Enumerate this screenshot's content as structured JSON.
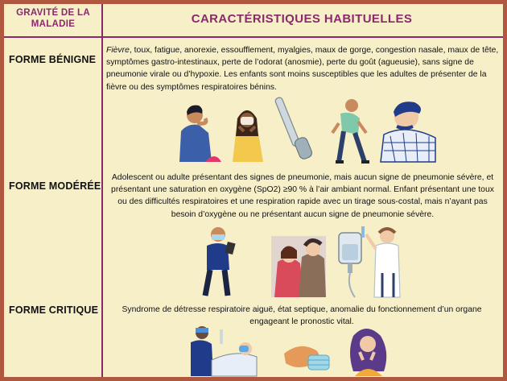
{
  "header": {
    "col_left": "GRAVITÉ DE LA MALADIE",
    "col_right": "CARACTÉRISTIQUES HABITUELLES"
  },
  "rows": [
    {
      "label": "FORME BÉNIGNE",
      "lead": "Fièvre",
      "text": ", toux, fatigue, anorexie, essoufflement, myalgies, maux de gorge, congestion nasale, maux de tête, symptômes gastro-intestinaux, perte de l’odorat (anosmie), perte du goût (agueusie), sans signe de pneumonie virale ou d’hypoxie. Les enfants sont moins susceptibles que les adultes de présenter de la fièvre ou des symptômes respiratoires bénins.",
      "icons": [
        "coughing-person-icon",
        "sneezing-woman-icon",
        "thermometer-icon",
        "tired-runner-icon",
        "coughing-man-icon"
      ]
    },
    {
      "label": "FORME MODÉRÉE",
      "text": "Adolescent ou adulte présentant des signes de pneumonie, mais aucun signe de pneumonie sévère, et présentant une saturation en oxygène (SpO2) ≥90 % à l’air ambiant normal. Enfant présentant une toux ou des difficultés respiratoires et une respiration rapide avec un tirage sous-costal, mais n’ayant pas besoin d’oxygène ou ne présentant aucun signe de pneumonie sévère.",
      "icons": [
        "doctor-tablet-icon",
        "coughing-couple-icon",
        "iv-drip-icon",
        "doctor-syringe-icon"
      ]
    },
    {
      "label": "FORME CRITIQUE",
      "text": "Syndrome de détresse respiratoire aiguë, état septique, anomalie du fonctionnement d’un organe engageant le pronostic vital.",
      "icons": [
        "hospital-bed-icon",
        "face-mask-icon",
        "worried-woman-icon"
      ]
    }
  ],
  "colors": {
    "border": "#b0573f",
    "accent": "#8a2a6a",
    "background": "#f6efc8"
  }
}
